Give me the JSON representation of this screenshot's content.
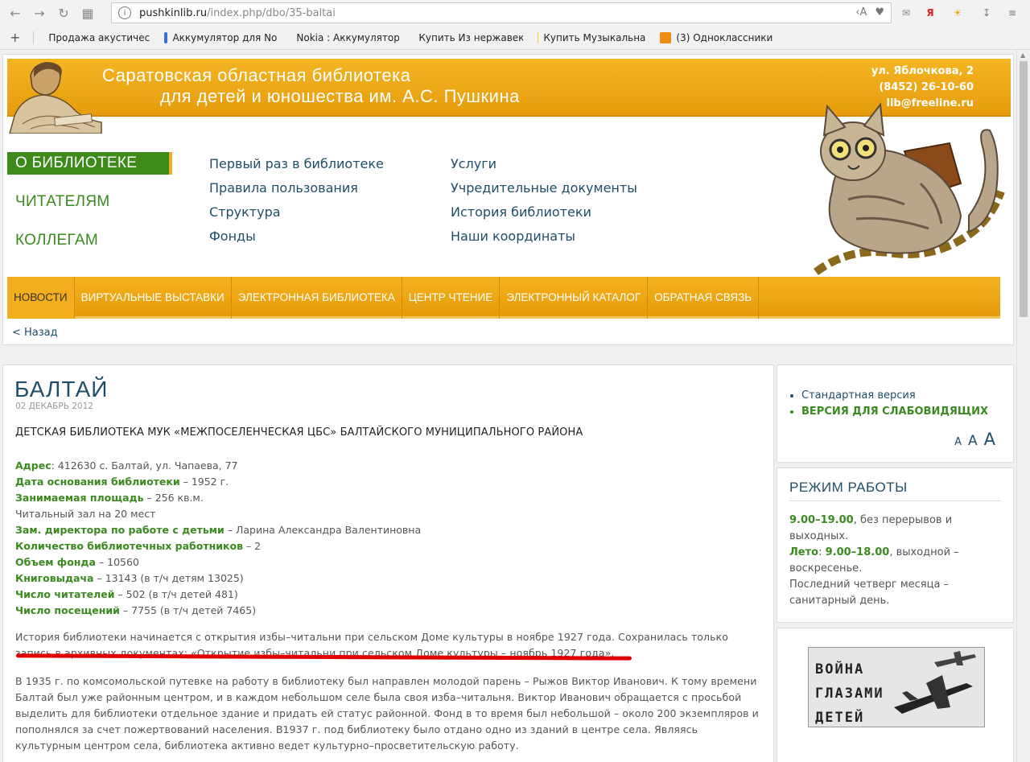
{
  "browser": {
    "url_host": "pushkinlib.ru",
    "url_path": "/index.php/dbo/35-baltai",
    "bookmarks": [
      {
        "label": "Продажа акустическ",
        "color": "#d12b2b"
      },
      {
        "label": "Аккумулятор для No",
        "color": "#3a6fd8"
      },
      {
        "label": "Nokia : Аккумулятор",
        "color": "#444444"
      },
      {
        "label": "Купить Из нержавек",
        "color": "#e8d21a"
      },
      {
        "label": "Купить Музыкальна",
        "color": "#e8d21a"
      },
      {
        "label": "(3) Одноклассники",
        "color": "#f08a12"
      }
    ]
  },
  "header": {
    "title_line1": "Саратовская областная библиотека",
    "title_line2": "для детей и юношества им. А.С. Пушкина",
    "address": "ул. Яблочкова, 2",
    "phone": "(8452) 26-10-60",
    "email": "lib@freeline.ru"
  },
  "side_menu": [
    "О БИБЛИОТЕКЕ",
    "ЧИТАТЕЛЯМ",
    "КОЛЛЕГАМ"
  ],
  "submenu_col1": [
    "Первый раз в библиотеке",
    "Правила пользования",
    "Структура",
    "Фонды"
  ],
  "submenu_col2": [
    "Услуги",
    "Учредительные документы",
    "История библиотеки",
    "Наши координаты"
  ],
  "main_nav": [
    "НОВОСТИ",
    "ВИРТУАЛЬНЫЕ ВЫСТАВКИ",
    "ЭЛЕКТРОННАЯ БИБЛИОТЕКА",
    "ЦЕНТР ЧТЕНИЕ",
    "ЭЛЕКТРОННЫЙ КАТАЛОГ",
    "ОБРАТНАЯ СВЯЗЬ"
  ],
  "back_link": "< Назад",
  "article": {
    "title": "БАЛТАЙ",
    "date": "02 ДЕКАБРЬ 2012",
    "subtitle": "ДЕТСКАЯ БИБЛИОТЕКА МУК «МЕЖПОСЕЛЕНЧЕСКАЯ ЦБС» БАЛТАЙСКОГО МУНИЦИПАЛЬНОГО РАЙОНА",
    "facts": [
      {
        "label": "Адрес",
        "value": ": 412630 с. Балтай, ул. Чапаева, 77"
      },
      {
        "label": "Дата основания библиотеки",
        "value": " – 1952 г."
      },
      {
        "label": "Занимаемая площадь",
        "value": " – 256 кв.м."
      },
      {
        "label": "",
        "value": "Читальный зал на 20 мест"
      },
      {
        "label": "Зам. директора по работе с детьми",
        "value": " – Ларина Александра Валентиновна"
      },
      {
        "label": "Количество библиотечных работников",
        "value": " – 2"
      },
      {
        "label": "Объем фонда",
        "value": " – 10560"
      },
      {
        "label": "Книговыдача",
        "value": " – 13143 (в т/ч детям 13025)"
      },
      {
        "label": "Число читателей",
        "value": " – 502 (в т/ч детей 481)"
      },
      {
        "label": "Число посещений",
        "value": " – 7755 (в т/ч детей 7465)"
      }
    ],
    "para1": "История библиотеки начинается с открытия избы–читальни при сельском Доме культуры в ноябре 1927 года. Сохранилась только запись в архивных документах: «Открытие избы–читальни при сельском Доме культуры – ноябрь 1927 года».",
    "para2": "В 1935 г. по комсомольской путевке на работу в библиотеку был направлен молодой парень – Рыжов Виктор Иванович. К тому времени Балтай был уже районным центром, и в каждом небольшом селе была своя изба–читальня. Виктор Иванович обращается с просьбой выделить для библиотеки отдельное здание и придать ей статус районной. Фонд в то время был небольшой – около 200 экземпляров и пополнялся за счет пожертвований населения. В1937 г. под библиотеку было отдано одно из зданий в центре села. Являясь культурным центром села, библиотека активно ведет культурно–просветительскую работу."
  },
  "version": {
    "standard": "Стандартная версия",
    "low_vision": "ВЕРСИЯ ДЛЯ СЛАБОВИДЯЩИХ",
    "sizes": [
      "A",
      "A",
      "A"
    ]
  },
  "hours": {
    "title": "РЕЖИМ РАБОТЫ",
    "line1_bold": "9.00–19.00",
    "line1_rest": ", без перерывов и выходных.",
    "line2_label": "Лето",
    "line2_sep": ": ",
    "line2_bold": "9.00–18.00",
    "line2_rest": ", выходной – воскресенье.",
    "line3": "Последний четверг месяца – санитарный день."
  },
  "war_banner": {
    "line1": "ВОЙНА",
    "line2": "ГЛАЗАМИ",
    "line3": "ДЕТЕЙ"
  }
}
